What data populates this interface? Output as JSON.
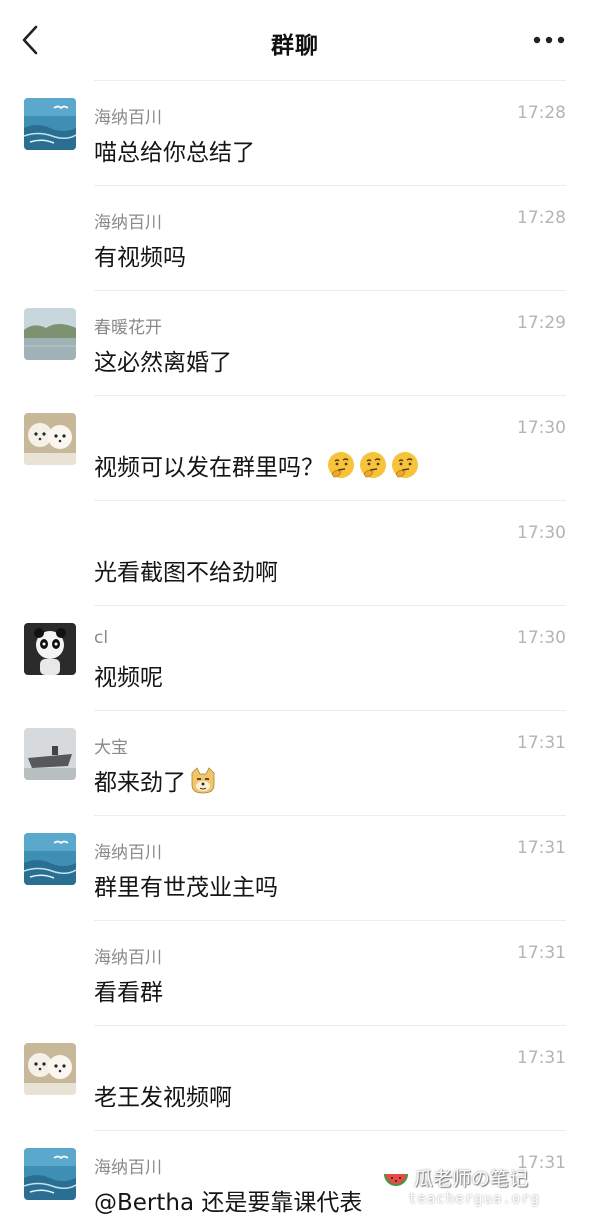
{
  "header": {
    "title": "群聊",
    "back_icon": "chevron-left-icon",
    "more_icon": "more-dots-icon"
  },
  "messages": [
    {
      "sender": "海纳百川",
      "time": "17:28",
      "text": "喵总给你总结了",
      "avatar": "seagull-sea"
    },
    {
      "sender": "海纳百川",
      "time": "17:28",
      "text": "有视频吗",
      "avatar": ""
    },
    {
      "sender": "春暖花开",
      "time": "17:29",
      "text": "这必然离婚了",
      "avatar": "lake-landscape"
    },
    {
      "sender": "",
      "time": "17:30",
      "text": "视频可以发在群里吗？",
      "avatar": "white-puppies",
      "emoji": [
        "thinking-face",
        "thinking-face",
        "thinking-face"
      ]
    },
    {
      "sender": "",
      "time": "17:30",
      "text": "光看截图不给劲啊",
      "avatar": ""
    },
    {
      "sender": "cl",
      "time": "17:30",
      "text": "视频呢",
      "avatar": "panda-figure"
    },
    {
      "sender": "大宝",
      "time": "17:31",
      "text": "都来劲了",
      "avatar": "aircraft-carrier",
      "emoji": [
        "doge-face"
      ]
    },
    {
      "sender": "海纳百川",
      "time": "17:31",
      "text": "群里有世茂业主吗",
      "avatar": "seagull-sea"
    },
    {
      "sender": "海纳百川",
      "time": "17:31",
      "text": "看看群",
      "avatar": ""
    },
    {
      "sender": "",
      "time": "17:31",
      "text": "老王发视频啊",
      "avatar": "white-puppies"
    },
    {
      "sender": "海纳百川",
      "time": "17:31",
      "text": "@Bertha 还是要靠课代表",
      "avatar": "seagull-sea"
    }
  ],
  "watermark": {
    "title": "瓜老师の笔记",
    "url": "teachergua.org"
  },
  "colors": {
    "background": "#ffffff",
    "divider": "#ececec",
    "sender": "#8a8a8a",
    "time": "#b4b4b4"
  }
}
